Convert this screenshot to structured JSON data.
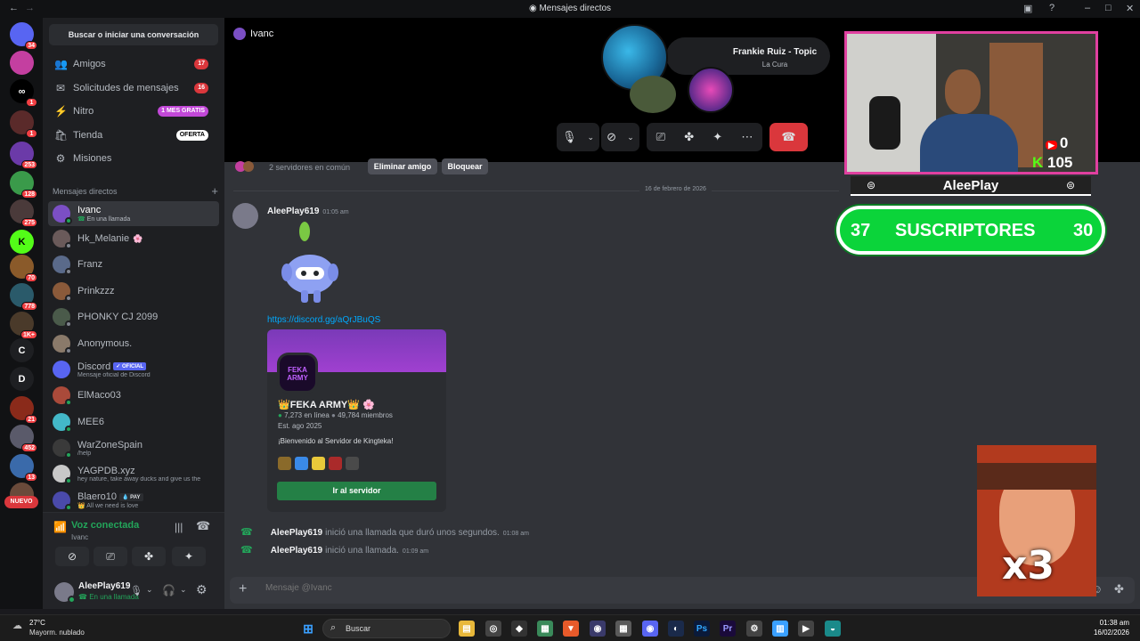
{
  "window": {
    "title": "Mensajes directos"
  },
  "rail": {
    "servers": [
      {
        "badge": "34",
        "color": "#5865f2",
        "label": ""
      },
      {
        "badge": "",
        "color": "#c43fa0",
        "label": ""
      },
      {
        "badge": "1",
        "color": "#000000",
        "label": "∞"
      },
      {
        "badge": "1",
        "color": "#5a2a2a",
        "label": ""
      },
      {
        "badge": "253",
        "color": "#6b3aa8",
        "label": ""
      },
      {
        "badge": "128",
        "color": "#3a9a4a",
        "label": ""
      },
      {
        "badge": "275",
        "color": "#4a3a3a",
        "label": ""
      },
      {
        "badge": "",
        "color": "#53fc18",
        "label": "K"
      },
      {
        "badge": "70",
        "color": "#8a5a2a",
        "label": ""
      },
      {
        "badge": "778",
        "color": "#2a5a6a",
        "label": ""
      },
      {
        "badge": "1K+",
        "color": "#4a3a2a",
        "label": ""
      },
      {
        "badge": "",
        "color": "#1e1f22",
        "label": "C"
      },
      {
        "badge": "",
        "color": "#1e1f22",
        "label": "D"
      },
      {
        "badge": "21",
        "color": "#8a2a1a",
        "label": ""
      },
      {
        "badge": "452",
        "color": "#5a5a6a",
        "label": ""
      },
      {
        "badge": "13",
        "color": "#3a6aaa",
        "label": ""
      },
      {
        "badge": "",
        "color": "#6a4a3a",
        "label": ""
      }
    ],
    "new_label": "NUEVO"
  },
  "sidebar": {
    "search_label": "Buscar o iniciar una conversación",
    "nav": [
      {
        "label": "Amigos",
        "badge": "17",
        "icon": "👥"
      },
      {
        "label": "Solicitudes de mensajes",
        "badge": "16",
        "icon": "✉"
      },
      {
        "label": "Nitro",
        "badge": "1 MES GRATIS",
        "icon": "⚡"
      },
      {
        "label": "Tienda",
        "badge": "OFERTA",
        "icon": "🛍"
      },
      {
        "label": "Misiones",
        "badge": "",
        "icon": "⚙"
      }
    ],
    "dm_header": "Mensajes directos",
    "add_dm": "+",
    "dms": [
      {
        "name": "Ivanc",
        "sub": "En una llamada",
        "color": "#7b4fc4",
        "status": "#23a55a",
        "suffix": "",
        "tag": ""
      },
      {
        "name": "Hk_Melanie",
        "sub": "",
        "color": "#6a5a5a",
        "status": "#80848e",
        "suffix": "🌸",
        "tag": ""
      },
      {
        "name": "Franz",
        "sub": "",
        "color": "#5a6a8a",
        "status": "#80848e",
        "suffix": "",
        "tag": ""
      },
      {
        "name": "Prinkzzz",
        "sub": "",
        "color": "#8a5a3a",
        "status": "#80848e",
        "suffix": "",
        "tag": ""
      },
      {
        "name": "PHONKY CJ 2099",
        "sub": "",
        "color": "#4a5a4a",
        "status": "#80848e",
        "suffix": "",
        "tag": ""
      },
      {
        "name": "Anonymous.",
        "sub": "",
        "color": "#8a7a6a",
        "status": "#80848e",
        "suffix": "",
        "tag": ""
      },
      {
        "name": "Discord",
        "sub": "Mensaje oficial de Discord",
        "color": "#5865f2",
        "status": "",
        "suffix": "",
        "tag": "✓ OFICIAL"
      },
      {
        "name": "ElMaco03",
        "sub": "",
        "color": "#aa4a3a",
        "status": "#23a55a",
        "suffix": "",
        "tag": ""
      },
      {
        "name": "MEE6",
        "sub": "",
        "color": "#43b8c8",
        "status": "#23a55a",
        "suffix": "",
        "tag": ""
      },
      {
        "name": "WarZoneSpain",
        "sub": "/help",
        "color": "#3a3a3a",
        "status": "#23a55a",
        "suffix": "",
        "tag": ""
      },
      {
        "name": "YAGPDB.xyz",
        "sub": "hey nature, take away ducks and give us the",
        "color": "#c8c8c8",
        "status": "#23a55a",
        "suffix": "",
        "tag": ""
      },
      {
        "name": "Blaero10",
        "sub": "All we need is love",
        "color": "#4a4aaa",
        "status": "#23a55a",
        "suffix": "",
        "tag": "💧 PAY"
      }
    ],
    "voice": {
      "status": "Voz conectada",
      "channel": "Ivanc"
    },
    "user": {
      "name": "AleePlay619",
      "status": "En una llamada"
    }
  },
  "call": {
    "header_name": "Ivanc",
    "now_playing_title": "Frankie Ruiz - Topic",
    "now_playing_sub": "La Cura"
  },
  "chat": {
    "common_servers": "2 servidores en común",
    "remove_friend": "Eliminar amigo",
    "block": "Bloquear",
    "date_divider": "16 de febrero de 2026",
    "message": {
      "author": "AleePlay619",
      "time": "01:05 am",
      "link": "https://discord.gg/aQrJBuQS"
    },
    "invite": {
      "name": "👑FEKA ARMY👑 🌸",
      "online": "7,273 en línea",
      "members": "49,784 miembros",
      "est": "Est. ago 2025",
      "desc": "¡Bienvenido al Servidor de Kingteka!",
      "button": "Ir al servidor",
      "logo_text": "FEKA ARMY"
    },
    "calls": [
      {
        "author": "AleePlay619",
        "text": "inició una llamada que duró unos segundos.",
        "time": "01:08 am"
      },
      {
        "author": "AleePlay619",
        "text": "inició una llamada.",
        "time": "01:09 am"
      }
    ],
    "input_placeholder": "Mensaje @Ivanc"
  },
  "overlay": {
    "yt_count": "0",
    "kick_count": "105",
    "streamer": "AleePlay",
    "subs_left": "37",
    "subs_label": "SUSCRIPTORES",
    "subs_right": "30",
    "meme_text": "x3"
  },
  "taskbar": {
    "weather_temp": "27°C",
    "weather_desc": "Mayorm. nublado",
    "search": "Buscar",
    "time": "01:38 am",
    "date": "16/02/2026"
  }
}
